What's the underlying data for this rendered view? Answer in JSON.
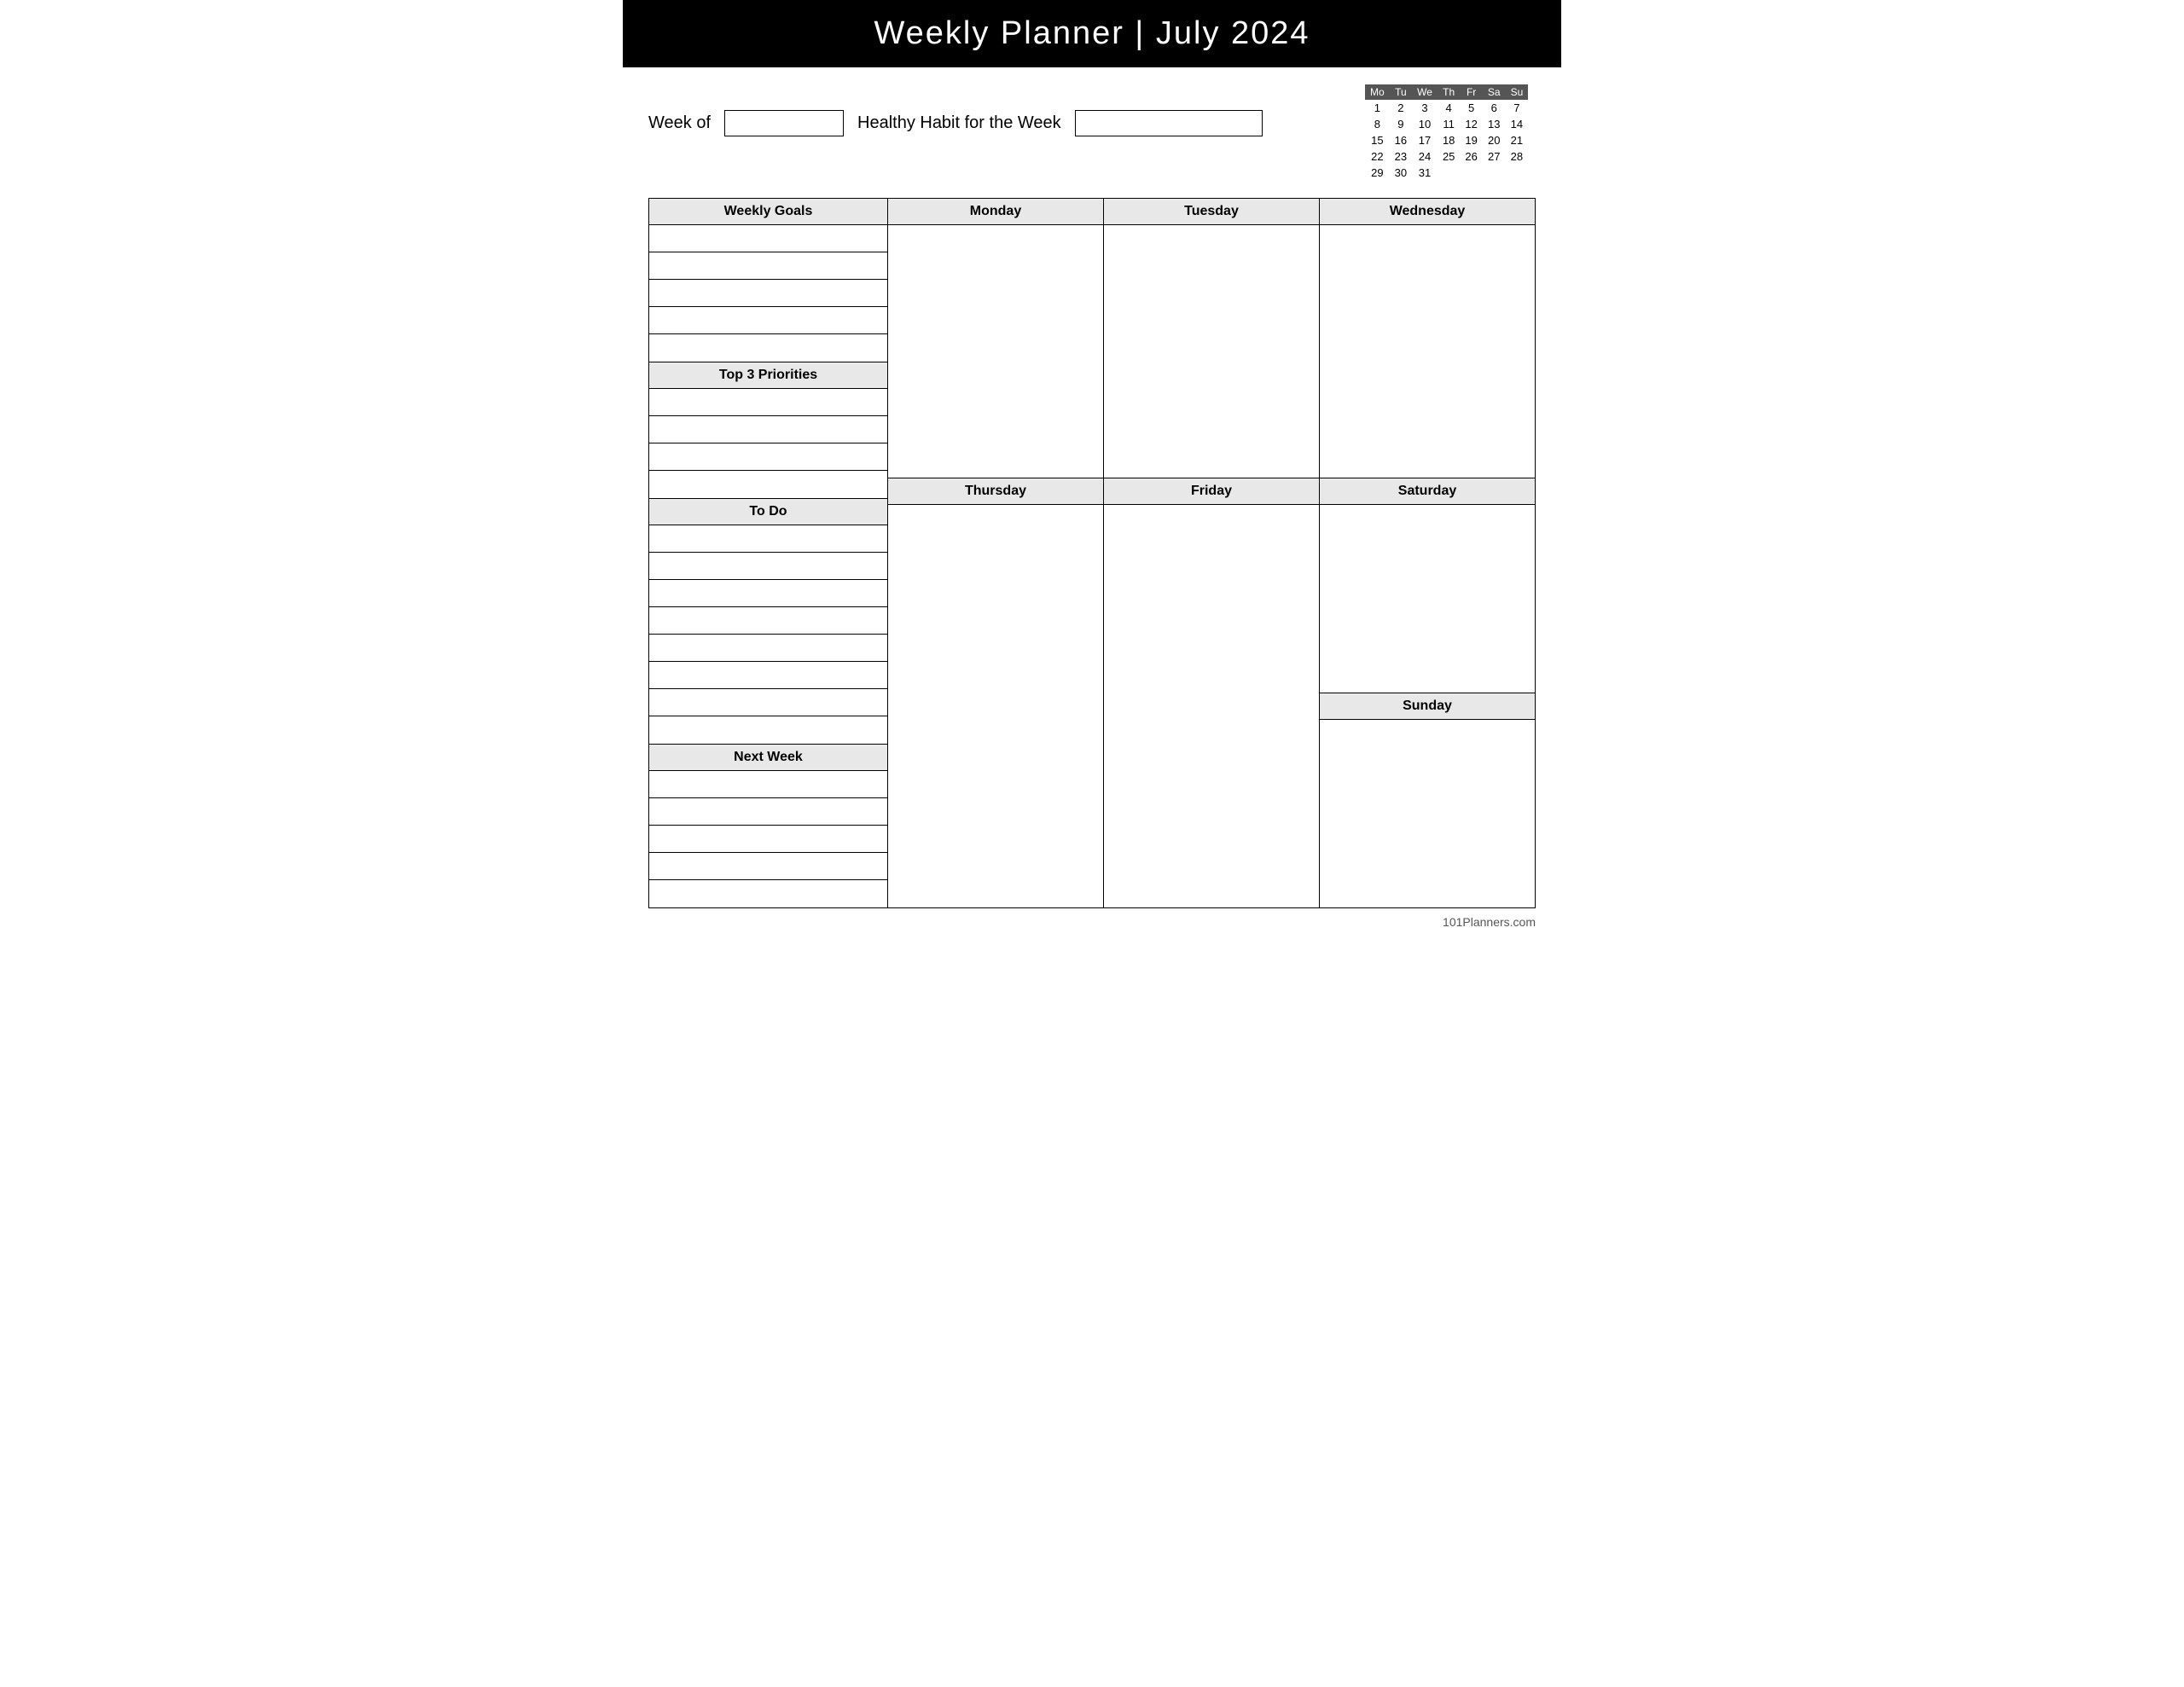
{
  "header": {
    "title": "Weekly Planner |  July 2024"
  },
  "week_of_label": "Week of",
  "healthy_habit_label": "Healthy Habit for the Week",
  "mini_calendar": {
    "month": "July 2024",
    "days_header": [
      "Mo",
      "Tu",
      "We",
      "Th",
      "Fr",
      "Sa",
      "Su"
    ],
    "weeks": [
      [
        "1",
        "2",
        "3",
        "4",
        "5",
        "6",
        "7"
      ],
      [
        "8",
        "9",
        "10",
        "11",
        "12",
        "13",
        "14"
      ],
      [
        "15",
        "16",
        "17",
        "18",
        "19",
        "20",
        "21"
      ],
      [
        "22",
        "23",
        "24",
        "25",
        "26",
        "27",
        "28"
      ],
      [
        "29",
        "30",
        "31",
        "",
        "",
        "",
        ""
      ]
    ]
  },
  "left_column": {
    "sections": [
      {
        "id": "weekly-goals",
        "header": "Weekly Goals",
        "rows": 5
      },
      {
        "id": "top-3-priorities",
        "header": "Top 3 Priorities",
        "rows": 4
      },
      {
        "id": "to-do",
        "header": "To Do",
        "rows": 8
      },
      {
        "id": "next-week",
        "header": "Next Week",
        "rows": 5
      }
    ]
  },
  "days_top": [
    "Monday",
    "Tuesday",
    "Wednesday"
  ],
  "days_bottom": [
    "Thursday",
    "Friday"
  ],
  "weekend": {
    "saturday": "Saturday",
    "sunday": "Sunday"
  },
  "footer": "101Planners.com"
}
